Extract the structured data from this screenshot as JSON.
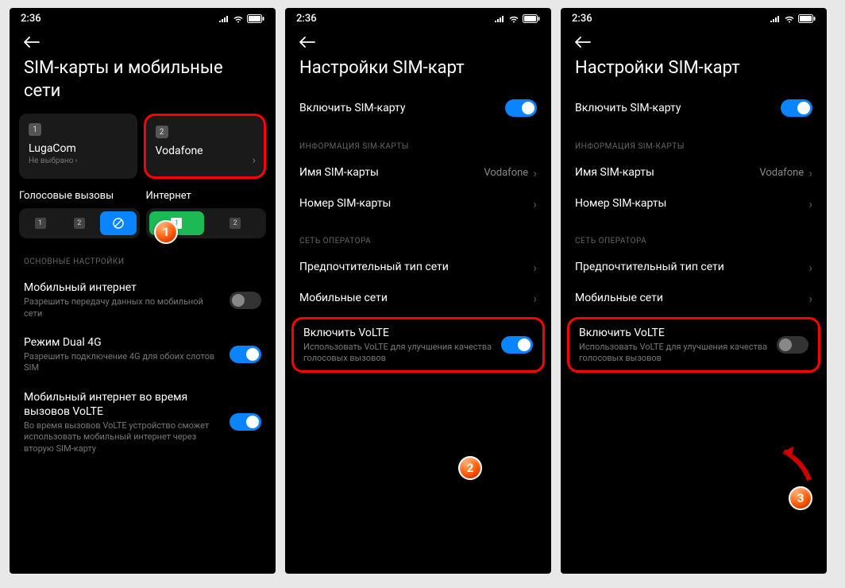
{
  "status_time": "2:36",
  "screen1": {
    "title": "SIM-карты и мобильные сети",
    "sim1": {
      "num": "1",
      "name": "LugaCom",
      "sub": "Не выбрано"
    },
    "sim2": {
      "num": "2",
      "name": "Vodafone",
      "sub": ""
    },
    "voice_label": "Голосовые вызовы",
    "internet_label": "Интернет",
    "section_main": "ОСНОВНЫЕ НАСТРОЙКИ",
    "mobile_internet": {
      "title": "Мобильный интернет",
      "sub": "Разрешить передачу данных по мобильной сети"
    },
    "dual4g": {
      "title": "Режим Dual 4G",
      "sub": "Разрешить подключение 4G для обоих слотов SIM"
    },
    "mi_volte": {
      "title": "Мобильный интернет во время вызовов VoLTE",
      "sub": "Во время вызовов VoLTE устройство сможет использовать мобильный интернет через вторую SIM-карту"
    }
  },
  "screen2": {
    "title": "Настройки SIM-карт",
    "enable_sim": "Включить SIM-карту",
    "section_info": "ИНФОРМАЦИЯ SIM-КАРТЫ",
    "sim_name_label": "Имя SIM-карты",
    "sim_name_value": "Vodafone",
    "sim_number_label": "Номер SIM-карты",
    "section_network": "СЕТЬ ОПЕРАТОРА",
    "pref_net": "Предпочтительный тип сети",
    "mobile_nets": "Мобильные сети",
    "volte": {
      "title": "Включить VoLTE",
      "sub": "Использовать VoLTE для улучшения качества голосовых вызовов"
    }
  },
  "callouts": {
    "c1": "1",
    "c2": "2",
    "c3": "3"
  },
  "toggles": {
    "screen1_mobile_internet": false,
    "screen1_dual4g": true,
    "screen1_mi_volte": true,
    "screen2_enable_sim": true,
    "screen2_volte": true,
    "screen3_enable_sim": true,
    "screen3_volte": false
  }
}
